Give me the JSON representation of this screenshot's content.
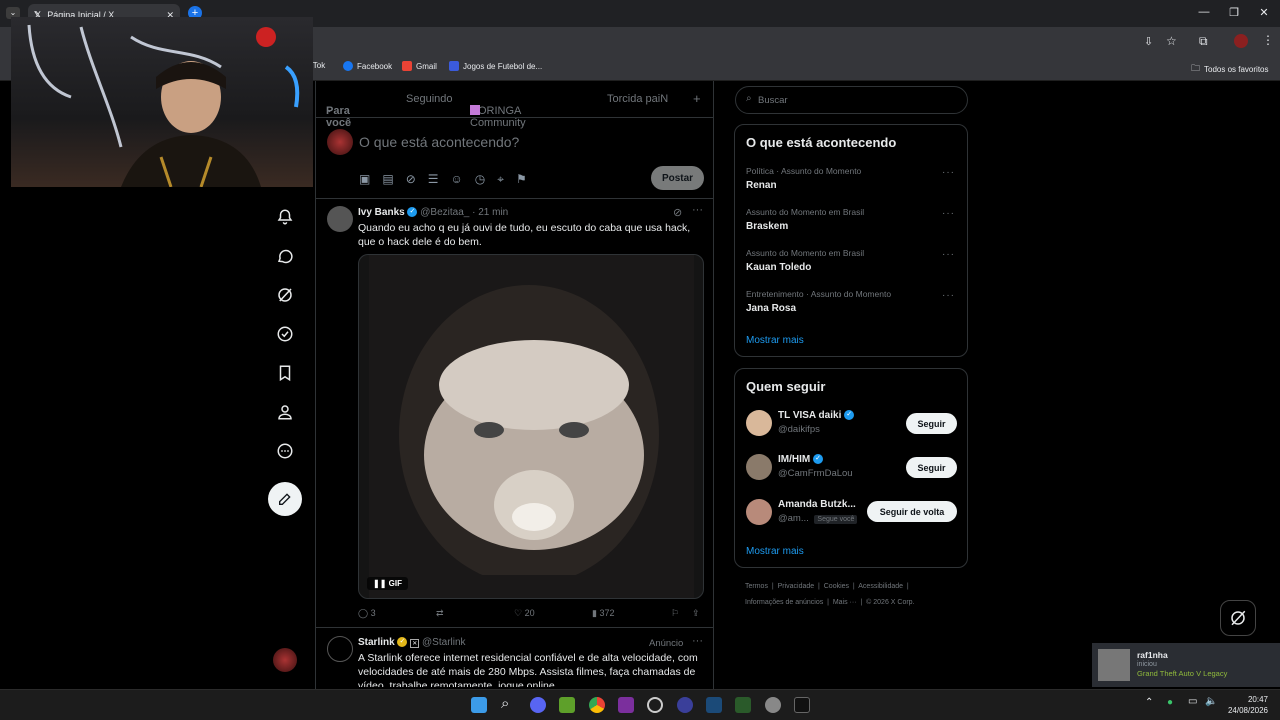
{
  "browser": {
    "tab_title": "Página Inicial / X",
    "bookmarks": [
      "ikTok",
      "Facebook",
      "Gmail",
      "Jogos de Futebol de..."
    ],
    "all_bookmarks": "Todos os favoritos"
  },
  "main": {
    "tabs": [
      "Para você",
      "Seguindo",
      "CORINGA Community",
      "Torcida paiN"
    ],
    "composer_placeholder": "O que está acontecendo?",
    "post_button": "Postar"
  },
  "tweet1": {
    "name": "Ivy Banks",
    "handle": "@Bezitaa_",
    "time": "· 21 min",
    "text": "Quando eu acho q eu já ouvi de tudo, eu escuto do caba que usa hack, que o hack dele é do bem.",
    "gif_label": "GIF",
    "replies": "3",
    "likes": "20",
    "views": "372"
  },
  "tweet2": {
    "name": "Starlink",
    "handle": "@Starlink",
    "ad": "Anúncio",
    "text": "A Starlink oferece internet residencial confiável e de alta velocidade, com velocidades de até mais de 280 Mbps. Assista filmes, faça chamadas de vídeo, trabalhe remotamente, jogue online..."
  },
  "search": {
    "placeholder": "Buscar"
  },
  "trends": {
    "title": "O que está acontecendo",
    "items": [
      {
        "category": "Política · Assunto do Momento",
        "name": "Renan"
      },
      {
        "category": "Assunto do Momento em Brasil",
        "name": "Braskem"
      },
      {
        "category": "Assunto do Momento em Brasil",
        "name": "Kauan Toledo"
      },
      {
        "category": "Entretenimento · Assunto do Momento",
        "name": "Jana Rosa"
      }
    ],
    "show_more": "Mostrar mais"
  },
  "who_to_follow": {
    "title": "Quem seguir",
    "items": [
      {
        "name": "TL VISA daiki",
        "handle": "@daikifps",
        "button": "Seguir"
      },
      {
        "name": "IM/HIM",
        "handle": "@CamFrmDaLou",
        "button": "Seguir"
      },
      {
        "name": "Amanda Butzk...",
        "handle": "@am...",
        "badge": "Segue você",
        "button": "Seguir de volta"
      }
    ],
    "show_more": "Mostrar mais"
  },
  "footer": {
    "line1": [
      "Termos",
      "Privacidade",
      "Cookies",
      "Acessibilidade"
    ],
    "line2": [
      "Informações de anúncios",
      "Mais ···",
      "© 2026 X Corp."
    ]
  },
  "notification": {
    "user": "raf1nha",
    "status": "iniciou",
    "game": "Grand Theft Auto V Legacy"
  },
  "clock": {
    "time": "20:47",
    "date": "24/08/2026"
  },
  "colors": {
    "accent": "#1d9bf0",
    "bg": "#000000",
    "border": "#2f3336",
    "muted": "#71767b"
  }
}
